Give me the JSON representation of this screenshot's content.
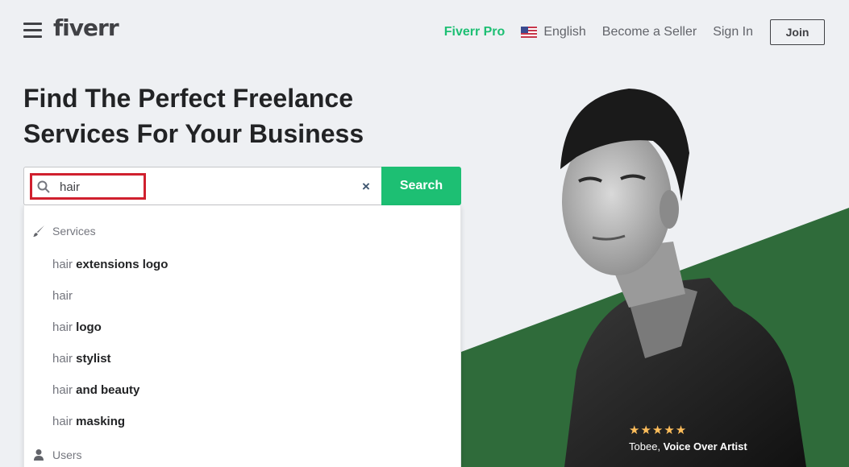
{
  "header": {
    "logo": "fiverr",
    "nav": {
      "pro": "Fiverr Pro",
      "language": "English",
      "become_seller": "Become a Seller",
      "sign_in": "Sign In",
      "join": "Join"
    }
  },
  "hero": {
    "headline_line1": "Find The Perfect Freelance",
    "headline_line2": "Services For Your Business",
    "rating_stars": "★★★★★",
    "person_name": "Tobee,",
    "person_role": "Voice Over Artist"
  },
  "search": {
    "value": "hair",
    "button_label": "Search",
    "clear_symbol": "×"
  },
  "dropdown": {
    "services_heading": "Services",
    "users_heading": "Users",
    "suggestions": [
      {
        "query": "hair",
        "rest": " extensions logo"
      },
      {
        "query": "hair",
        "rest": ""
      },
      {
        "query": "hair",
        "rest": " logo"
      },
      {
        "query": "hair",
        "rest": " stylist"
      },
      {
        "query": "hair",
        "rest": " and beauty"
      },
      {
        "query": "hair",
        "rest": " masking"
      }
    ]
  },
  "colors": {
    "brand_green": "#1dbf73",
    "hero_green": "#2f6b3a",
    "highlight_red": "#d0202e",
    "star": "#ffbe5b"
  }
}
